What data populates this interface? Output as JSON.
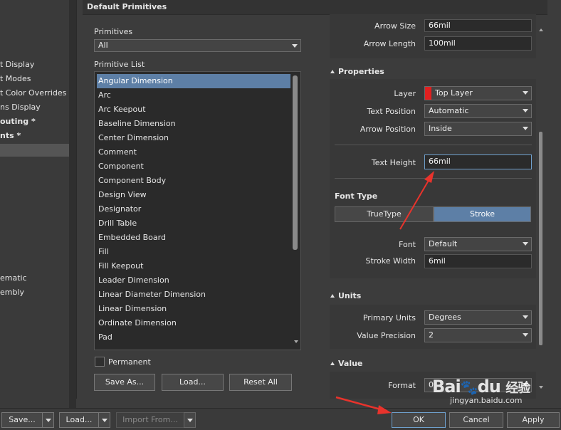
{
  "sidebar": {
    "items": [
      {
        "label": "t Display",
        "bold": false,
        "selected": false
      },
      {
        "label": "t Modes",
        "bold": false,
        "selected": false
      },
      {
        "label": "t Color Overrides",
        "bold": false,
        "selected": false
      },
      {
        "label": "ns Display",
        "bold": false,
        "selected": false
      },
      {
        "label": "outing *",
        "bold": true,
        "selected": false
      },
      {
        "label": "nts *",
        "bold": true,
        "selected": false
      },
      {
        "label": "",
        "bold": false,
        "selected": true
      },
      {
        "label": "ematic",
        "bold": false,
        "selected": false
      },
      {
        "label": "embly",
        "bold": false,
        "selected": false
      }
    ]
  },
  "panel": {
    "title": "Default Primitives",
    "primitives_label": "Primitives",
    "primitives_value": "All",
    "list_label": "Primitive List",
    "list": [
      "Angular Dimension",
      "Arc",
      "Arc Keepout",
      "Baseline Dimension",
      "Center Dimension",
      "Comment",
      "Component",
      "Component Body",
      "Design View",
      "Designator",
      "Drill Table",
      "Embedded Board",
      "Fill",
      "Fill Keepout",
      "Leader Dimension",
      "Linear Diameter Dimension",
      "Linear Dimension",
      "Ordinate Dimension",
      "Pad"
    ],
    "permanent_label": "Permanent",
    "save_as": "Save As...",
    "load": "Load...",
    "reset_all": "Reset All"
  },
  "props": {
    "arrow_size_label": "Arrow Size",
    "arrow_size": "66mil",
    "arrow_length_label": "Arrow Length",
    "arrow_length": "100mil",
    "properties_head": "Properties",
    "layer_label": "Layer",
    "layer_value": "Top Layer",
    "layer_color": "#e02020",
    "text_position_label": "Text Position",
    "text_position": "Automatic",
    "arrow_position_label": "Arrow Position",
    "arrow_position": "Inside",
    "text_height_label": "Text Height",
    "text_height": "66mil",
    "font_type_head": "Font Type",
    "truetype": "TrueType",
    "stroke": "Stroke",
    "font_label": "Font",
    "font_value": "Default",
    "stroke_width_label": "Stroke Width",
    "stroke_width": "6mil",
    "units_head": "Units",
    "primary_units_label": "Primary Units",
    "primary_units": "Degrees",
    "value_precision_label": "Value Precision",
    "value_precision": "2",
    "value_head": "Value",
    "format_label": "Format",
    "format_value": "0"
  },
  "bottom": {
    "save": "Save...",
    "load": "Load...",
    "import_from": "Import From...",
    "ok": "OK",
    "cancel": "Cancel",
    "apply": "Apply"
  },
  "watermark": {
    "brand": "Bai",
    "brand2": "百度",
    "sub": "经验",
    "url": "jingyan.baidu.com"
  },
  "colors": {
    "accent": "#5d7fa6",
    "annotation": "#e8332c"
  }
}
